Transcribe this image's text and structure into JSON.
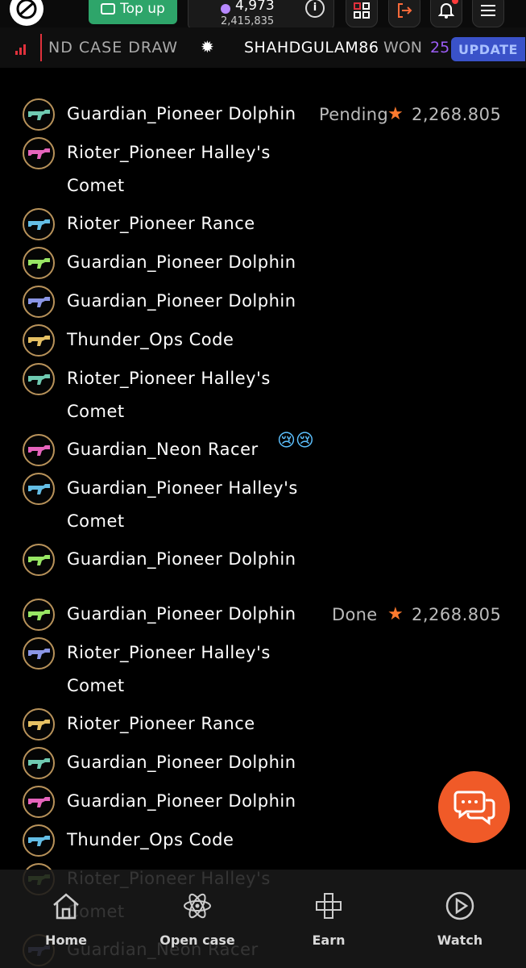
{
  "topbar": {
    "topup_label": "Top up",
    "wallet_balance": "4,973",
    "wallet_sub": "2,415,835",
    "info_label": "i"
  },
  "ticker": {
    "text": "ND CASE DRAW",
    "username": "SHAHDGULAM86",
    "won_label": "WON",
    "won_value": "25",
    "update_label": "UPDATE"
  },
  "groups": [
    {
      "status": "Pending",
      "amount": "2,268.805",
      "items": [
        "Guardian_Pioneer Dolphin",
        "Rioter_Pioneer Halley's Comet",
        "Rioter_Pioneer Rance",
        "Guardian_Pioneer Dolphin",
        "Guardian_Pioneer Dolphin",
        "Thunder_Ops Code",
        "Rioter_Pioneer Halley's Comet",
        "Guardian_Neon Racer",
        "Guardian_Pioneer Halley's Comet",
        "Guardian_Pioneer Dolphin"
      ]
    },
    {
      "status": "Done",
      "amount": "2,268.805",
      "items": [
        "Guardian_Pioneer Dolphin",
        "Rioter_Pioneer Halley's Comet",
        "Rioter_Pioneer Rance",
        "Guardian_Pioneer Dolphin",
        "Guardian_Pioneer Dolphin",
        "Thunder_Ops Code",
        "Rioter_Pioneer Halley's Comet",
        "Guardian_Neon Racer"
      ]
    }
  ],
  "emoji": "😢😢",
  "nav": [
    {
      "label": "Home",
      "icon": "home-icon"
    },
    {
      "label": "Open case",
      "icon": "atom-icon"
    },
    {
      "label": "Earn",
      "icon": "gamepad-icon"
    },
    {
      "label": "Watch",
      "icon": "play-icon"
    }
  ],
  "colors": {
    "accent": "#f05a28",
    "topup": "#2ea56a",
    "update": "#3a52c9"
  }
}
